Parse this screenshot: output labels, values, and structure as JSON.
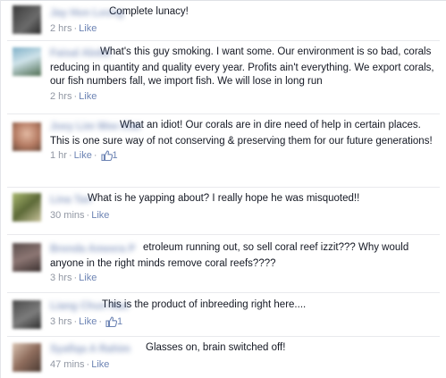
{
  "comments": [
    {
      "name": "Jay Hon Leong",
      "text": "Complete lunacy!",
      "time": "2 hrs",
      "like": "Like",
      "likes": ""
    },
    {
      "name": "Faisal Abdul",
      "text": "What's this guy smoking. I want some. Our environment is so bad, corals reducing in quantity and quality every year. Profits ain't everything. We export corals, our fish numbers fall, we import fish. We will lose in long run",
      "time": "2 hrs",
      "like": "Like",
      "likes": ""
    },
    {
      "name": "Joey Lim Wee Kiat",
      "text": "What an idiot! Our corals are in dire need of help in certain places. This is one sure way of not conserving & preserving them for our future generations!",
      "time": "1 hr",
      "like": "Like",
      "likes": "1"
    },
    {
      "name": "Lina Tan",
      "text": "What is he yapping about? I really hope he was misquoted!!",
      "time": "30 mins",
      "like": "Like",
      "likes": ""
    },
    {
      "name": "Brenda Ameera P",
      "text": "etroleum running out, so sell coral reef izzit??? Why would anyone in the right minds remove coral reefs????",
      "time": "3 hrs",
      "like": "Like",
      "likes": ""
    },
    {
      "name": "Liang Chun Hao",
      "text": "This is the product of inbreeding right here....",
      "time": "3 hrs",
      "like": "Like",
      "likes": "1"
    },
    {
      "name": "Syafiqa A Rahim",
      "text": "Glasses on, brain switched off!",
      "time": "47 mins",
      "like": "Like",
      "likes": ""
    }
  ],
  "colors": {
    "link": "#6d84b4",
    "name": "#3b5998",
    "meta": "#9197a3",
    "text": "#141823"
  },
  "icons": {
    "likes_icon": "thumbs-up-icon"
  }
}
